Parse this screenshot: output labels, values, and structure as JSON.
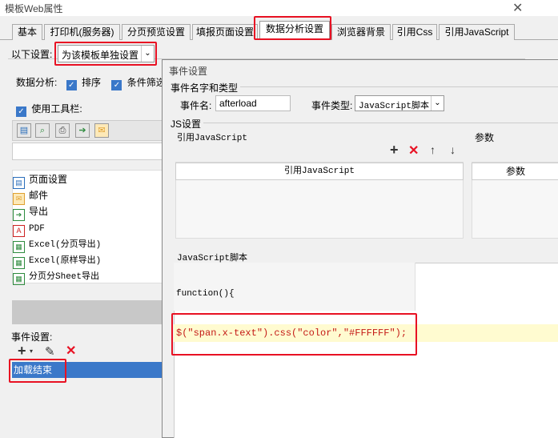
{
  "window": {
    "title": "模板Web属性",
    "close": "✕"
  },
  "tabs": [
    {
      "label": "基本"
    },
    {
      "label": "打印机(服务器)"
    },
    {
      "label": "分页预览设置"
    },
    {
      "label": "填报页面设置"
    },
    {
      "label": "数据分析设置"
    },
    {
      "label": "浏览器背景"
    },
    {
      "label": "引用Css"
    },
    {
      "label": "引用JavaScript"
    }
  ],
  "settings": {
    "label": "以下设置:",
    "value": "为该模板单独设置",
    "arrow": "⌄"
  },
  "analysis": {
    "label": "数据分析:",
    "sort": "排序",
    "filter": "条件筛选"
  },
  "toolbar": {
    "label": "使用工具栏:"
  },
  "list": [
    {
      "label": "页面设置",
      "icon": "page-setup-icon",
      "glyph": "▤",
      "color": "#2a6ebb"
    },
    {
      "label": "邮件",
      "icon": "mail-icon",
      "glyph": "✉",
      "color": "#e0a030"
    },
    {
      "label": "导出",
      "icon": "export-icon",
      "glyph": "➔",
      "color": "#2e8b3e"
    },
    {
      "label": "PDF",
      "icon": "pdf-icon",
      "glyph": "A",
      "color": "#cc2222"
    },
    {
      "label": "Excel(分页导出)",
      "icon": "excel-icon",
      "glyph": "▦",
      "color": "#2e8b3e"
    },
    {
      "label": "Excel(原样导出)",
      "icon": "excel-icon",
      "glyph": "▦",
      "color": "#2e8b3e"
    },
    {
      "label": "分页分Sheet导出",
      "icon": "excel-icon",
      "glyph": "▦",
      "color": "#2e8b3e"
    }
  ],
  "events": {
    "label": "事件设置:",
    "item": "加载结束"
  },
  "dialog": {
    "title": "事件设置",
    "name_group": "事件名字和类型",
    "name_label": "事件名:",
    "name_value": "afterload",
    "type_label": "事件类型:",
    "type_value": "JavaScript脚本",
    "js_group": "JS设置",
    "ref_js_label": "引用JavaScript",
    "params_label": "参数",
    "ref_js_header": "引用JavaScript",
    "params_header": "参数",
    "script_label": "JavaScript脚本",
    "code_line1": "function(){",
    "code_line2": "$(\"span.x-text\").css(\"color\",\"#FFFFFF\");"
  },
  "colors": {
    "accent": "#3a78c9",
    "highlight": "#e81123",
    "code_line_bg": "#fffbd0",
    "selected_bg": "#3a78c9"
  }
}
